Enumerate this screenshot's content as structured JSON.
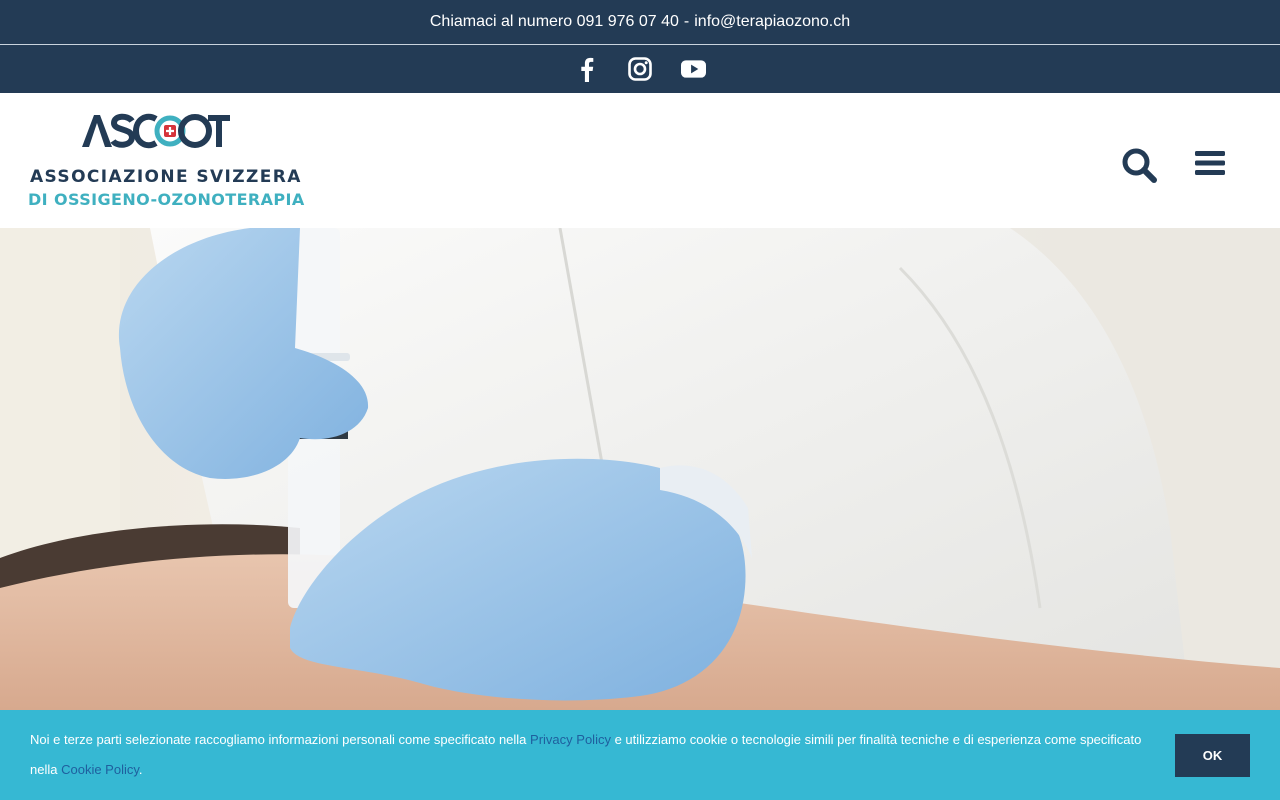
{
  "topbar": {
    "phone_text": "Chiamaci al numero 091 976 07 40",
    "separator": "-",
    "email": "info@terapiaozono.ch"
  },
  "social": {
    "items": [
      {
        "name": "facebook-icon",
        "label": "Facebook"
      },
      {
        "name": "instagram-icon",
        "label": "Instagram"
      },
      {
        "name": "youtube-icon",
        "label": "YouTube"
      }
    ]
  },
  "header": {
    "logo_text": "ASOOT",
    "logo_line1": "ASSOCIAZIONE SVIZZERA",
    "logo_line2": "DI OSSIGENO-OZONOTERAPIA",
    "search_icon": "search-icon",
    "menu_icon": "hamburger-menu-icon"
  },
  "hero": {
    "image": "photo of gloved doctor performing ozone injection with syringe on patient's back"
  },
  "cookie": {
    "text_before": "Noi e terze parti selezionate raccogliamo informazioni personali come specificato nella",
    "privacy_link": "Privacy Policy",
    "text_middle": "e utilizziamo cookie o tecnologie simili per finalità tecniche e di esperienza come specificato nella",
    "cookie_link": "Cookie Policy",
    "text_end": ".",
    "ok_label": "OK"
  },
  "colors": {
    "navy": "#233b55",
    "teal": "#3fb0c0",
    "cookie_bg": "#36b8d3",
    "link": "#1f5f9e"
  }
}
